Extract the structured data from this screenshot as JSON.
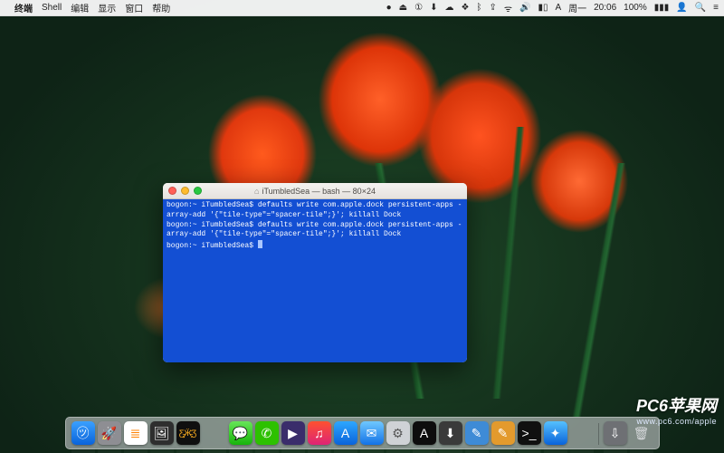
{
  "menubar": {
    "apple": "",
    "app_name": "终端",
    "items": [
      "Shell",
      "编辑",
      "显示",
      "窗口",
      "帮助"
    ],
    "right": {
      "icons": [
        "●",
        "⏏",
        "①",
        "⬇",
        "☁",
        "❖",
        "ᛒ",
        "⇪",
        "ᯤ",
        "🔊",
        "▮▯",
        "A"
      ],
      "day": "周一",
      "time": "20:06",
      "battery_pct": "100%",
      "battery_icon": "▮▮▮",
      "user": "👤",
      "search": "🔍",
      "menu": "≡"
    }
  },
  "terminal": {
    "title_prefix": "iTumbledSea — bash — 80×24",
    "lines": [
      "bogon:~ iTumbledSea$ defaults write com.apple.dock persistent-apps -array-add '{\"tile-type\"=\"spacer-tile\";}'; killall Dock",
      "bogon:~ iTumbledSea$ defaults write com.apple.dock persistent-apps -array-add '{\"tile-type\"=\"spacer-tile\";}'; killall Dock",
      "bogon:~ iTumbledSea$ "
    ]
  },
  "dock": {
    "apps": [
      {
        "name": "finder",
        "glyph": "㋡",
        "bg": "linear-gradient(#3aa0ff,#0a63da)"
      },
      {
        "name": "launchpad",
        "glyph": "🚀",
        "bg": "#8e8e93"
      },
      {
        "name": "reminders",
        "glyph": "≣",
        "bg": "#ffffff",
        "fg": "#ff8000"
      },
      {
        "name": "preview",
        "glyph": "🖼",
        "bg": "#2e2e2e"
      },
      {
        "name": "butterfly",
        "glyph": "Ƹ̵̡Ӝ̵̨̄Ʒ",
        "bg": "#0f0f0f",
        "fg": "#ffb020"
      },
      {
        "name": "spacer1",
        "glyph": "",
        "bg": "transparent",
        "shadow": false
      },
      {
        "name": "messages",
        "glyph": "💬",
        "bg": "linear-gradient(#67e558,#17b40b)"
      },
      {
        "name": "wechat",
        "glyph": "✆",
        "bg": "#2dc100"
      },
      {
        "name": "mpv",
        "glyph": "▶",
        "bg": "#3a2d6b"
      },
      {
        "name": "itunes",
        "glyph": "♫",
        "bg": "linear-gradient(#ff512f,#dd2476)"
      },
      {
        "name": "appstore",
        "glyph": "A",
        "bg": "linear-gradient(#2ea7ff,#0a63da)"
      },
      {
        "name": "mail",
        "glyph": "✉",
        "bg": "linear-gradient(#6fc8ff,#1372e6)"
      },
      {
        "name": "settings",
        "glyph": "⚙",
        "bg": "#cfd2d6",
        "fg": "#555"
      },
      {
        "name": "fontbook",
        "glyph": "A",
        "bg": "#0d0d0d"
      },
      {
        "name": "download",
        "glyph": "⬇",
        "bg": "#3a3a3a"
      },
      {
        "name": "folder",
        "glyph": "✎",
        "bg": "#3e8bd6"
      },
      {
        "name": "notes",
        "glyph": "✎",
        "bg": "#e39a2d"
      },
      {
        "name": "terminal",
        "glyph": ">_",
        "bg": "#101010"
      },
      {
        "name": "safari",
        "glyph": "✦",
        "bg": "linear-gradient(#55c1ff,#0a63da)"
      },
      {
        "name": "spacer2",
        "glyph": "",
        "bg": "transparent",
        "shadow": false
      }
    ],
    "tray": [
      {
        "name": "downloads-stack",
        "glyph": "⇩",
        "bg": "#6e7074"
      },
      {
        "name": "trash",
        "glyph": "🗑",
        "bg": "transparent",
        "fg": "#d7d9dc",
        "shadow": false
      }
    ]
  },
  "watermark": {
    "l1": "PC6苹果网",
    "l2": "www.pc6.com/apple"
  }
}
